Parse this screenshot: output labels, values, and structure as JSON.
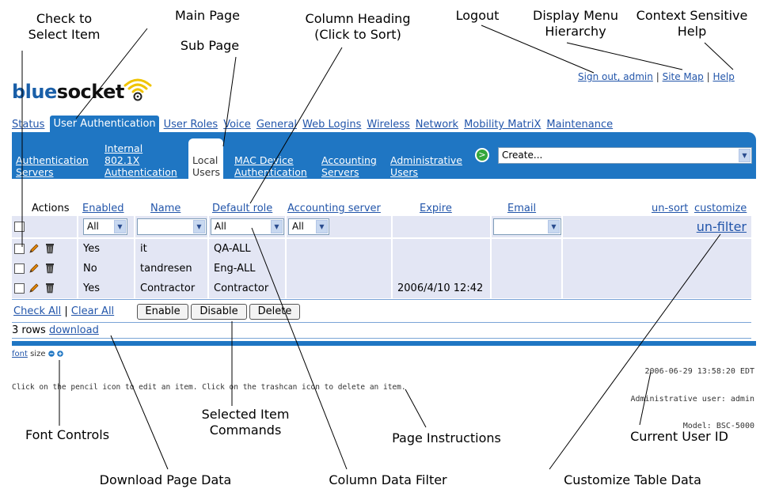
{
  "callouts": {
    "check_select": [
      "Check to",
      "Select Item"
    ],
    "main_page": "Main Page",
    "sub_page": "Sub Page",
    "column_heading": [
      "Column Heading",
      "(Click to Sort)"
    ],
    "logout": "Logout",
    "display_menu": [
      "Display Menu",
      "Hierarchy"
    ],
    "context_help": [
      "Context Sensitive",
      "Help"
    ],
    "font_controls": "Font Controls",
    "selected_item": [
      "Selected Item",
      "Commands"
    ],
    "page_instructions": "Page Instructions",
    "current_user": "Current User ID",
    "download_page": "Download Page Data",
    "column_filter": "Column Data Filter",
    "customize_table": "Customize Table Data"
  },
  "header": {
    "sign_out": "Sign out, admin",
    "sep1": "|",
    "site_map": "Site Map",
    "sep2": "|",
    "help": "Help"
  },
  "logo": {
    "part1": "blue",
    "part2": "socket"
  },
  "main_tabs": [
    "Status",
    "User Authentication",
    "User Roles",
    "Voice",
    "General",
    "Web Logins",
    "Wireless",
    "Network",
    "Mobility MatriX",
    "Maintenance"
  ],
  "sub_tabs": {
    "auth_servers": [
      "Authentication",
      "Servers"
    ],
    "internal_8021x": [
      "Internal",
      "802.1X",
      "Authentication"
    ],
    "local_users": [
      "Local",
      "Users"
    ],
    "mac_device": [
      "MAC Device",
      "Authentication"
    ],
    "accounting": [
      "Accounting",
      "Servers"
    ],
    "admin_users": [
      "Administrative",
      "Users"
    ]
  },
  "go_symbol": ">",
  "create_select": "Create...",
  "table": {
    "headers": {
      "actions": "Actions",
      "enabled": "Enabled",
      "name": "Name",
      "default_role": "Default role",
      "accounting_server": "Accounting server",
      "expire": "Expire",
      "email": "Email",
      "unsort": "un-sort",
      "customize": "customize"
    },
    "filters": {
      "enabled": "All",
      "name": "",
      "default_role": "All",
      "accounting": "All",
      "email": "",
      "unfilter": "un-filter"
    },
    "rows": [
      {
        "enabled": "Yes",
        "name": "it",
        "role": "QA-ALL",
        "accounting": "",
        "expire": "",
        "email": ""
      },
      {
        "enabled": "No",
        "name": "tandresen",
        "role": "Eng-ALL",
        "accounting": "",
        "expire": "",
        "email": ""
      },
      {
        "enabled": "Yes",
        "name": "Contractor",
        "role": "Contractor",
        "accounting": "",
        "expire": "2006/4/10 12:42",
        "email": ""
      }
    ]
  },
  "actions_bar": {
    "check_all": "Check All",
    "sep": "|",
    "clear_all": "Clear All",
    "enable": "Enable",
    "disable": "Disable",
    "delete": "Delete"
  },
  "rows_info": {
    "count": "3 rows",
    "download": "download"
  },
  "font_ctl": {
    "font": "font",
    "size": "size"
  },
  "status_lines": [
    "2006-06-29 13:58:20 EDT",
    "Administrative user: admin",
    "Model: BSC-5000"
  ],
  "instructions": "Click on the pencil icon to edit an item. Click on the trashcan icon to delete an item.",
  "colors": {
    "blue": "#1f76c3",
    "row": "#e3e6f4",
    "link": "#2255aa",
    "go": "#34a63a",
    "wifi": "#f0c400"
  }
}
